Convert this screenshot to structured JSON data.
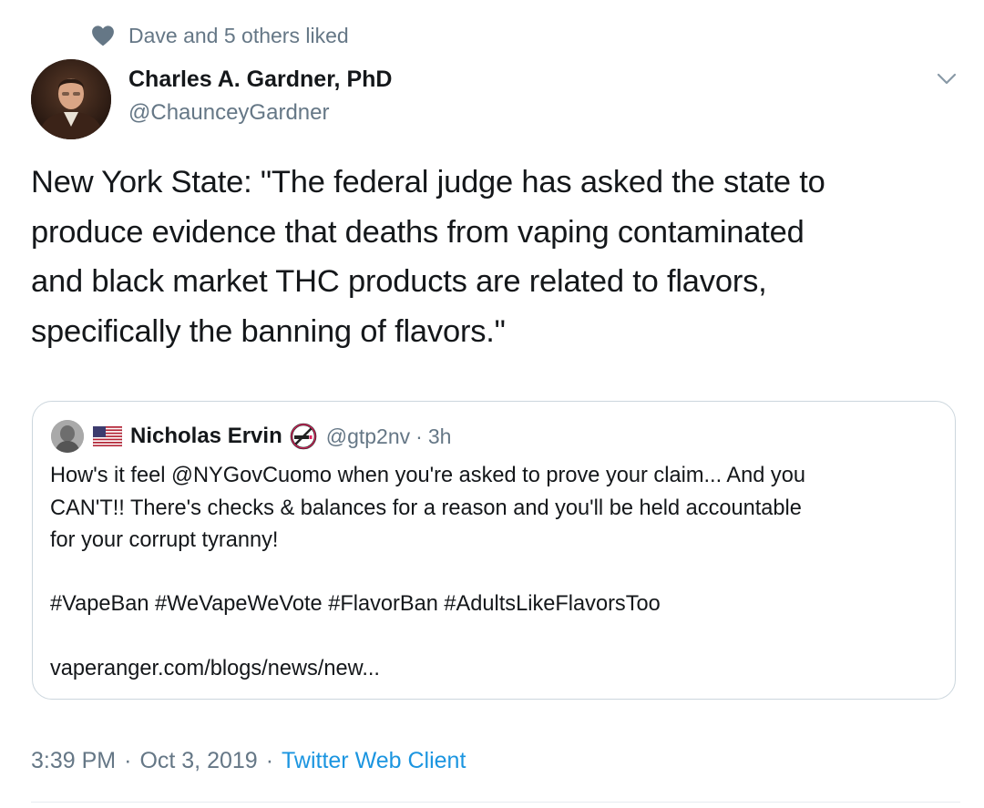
{
  "social_context": {
    "text": "Dave and 5 others liked",
    "icon": "heart-icon"
  },
  "tweet": {
    "author": {
      "name": "Charles A. Gardner, PhD",
      "handle": "@ChaunceyGardner"
    },
    "text": "New York State:  \"The federal judge has asked the state to\nproduce evidence that deaths from vaping contaminated\nand black market THC products are related to flavors,\nspecifically the banning of flavors.\"",
    "timestamp": "3:39 PM",
    "date": "Oct 3, 2019",
    "separator": "·",
    "source": "Twitter Web Client"
  },
  "quoted_tweet": {
    "name": "Nicholas Ervin",
    "handle": "@gtp2nv",
    "separator": "·",
    "time": "3h",
    "text": "How's it feel @NYGovCuomo when you're asked to prove your claim... And you\nCAN'T!! There's checks & balances for a reason and you'll be held accountable\nfor your corrupt tyranny!",
    "hashtags": "#VapeBan #WeVapeWeVote #FlavorBan #AdultsLikeFlavorsToo",
    "link": "vaperanger.com/blogs/news/new..."
  },
  "colors": {
    "text_primary": "#14171a",
    "text_secondary": "#657786",
    "link_blue": "#1b95e0",
    "border": "#ccd6dd"
  }
}
